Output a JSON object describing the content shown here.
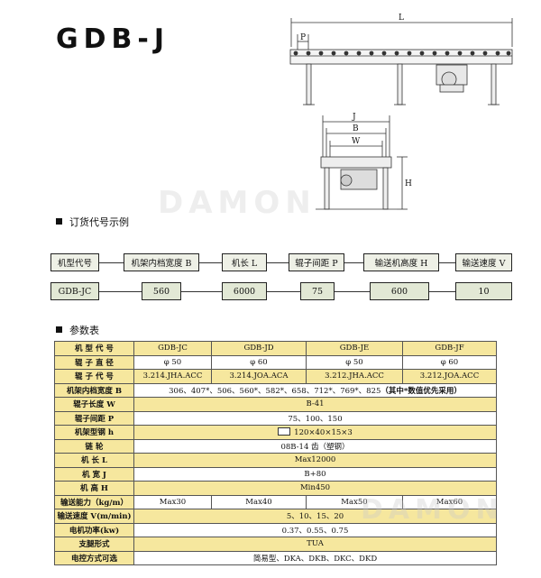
{
  "title": "GDB-J",
  "drawing": {
    "dim_L": "L",
    "dim_P": "P",
    "dim_J": "J",
    "dim_B": "B",
    "dim_W": "W",
    "dim_H": "H"
  },
  "watermark": "DAMON",
  "order": {
    "heading": "订货代号示例",
    "labels": [
      "机型代号",
      "机架内档宽度 B",
      "机长 L",
      "辊子间距 P",
      "输送机高度 H",
      "输送速度  V"
    ],
    "values": [
      "GDB-JC",
      "560",
      "6000",
      "75",
      "600",
      "10"
    ]
  },
  "params": {
    "heading": "参数表",
    "rows": [
      {
        "label": "机 型 代 号",
        "cells": [
          "GDB-JC",
          "GDB-JD",
          "GDB-JE",
          "GDB-JF"
        ]
      },
      {
        "label": "辊 子 直 径",
        "cells": [
          "φ 50",
          "φ 60",
          "φ 50",
          "φ 60"
        ]
      },
      {
        "label": "辊 子 代 号",
        "cells": [
          "3.214.JHA.ACC",
          "3.214.JOA.ACA",
          "3.212.JHA.ACC",
          "3.212.JOA.ACC"
        ]
      },
      {
        "label": "机架内档宽度 B",
        "span": "306、407*、506、560*、582*、658、712*、769*、825",
        "note": "（其中*数值优先采用）"
      },
      {
        "label": "辊子长度 W",
        "span": "B-41"
      },
      {
        "label": "辊子间距 P",
        "span": "75、100、150"
      },
      {
        "label": "机架型钢 h",
        "span": "120×40×15×3",
        "box_symbol": true
      },
      {
        "label": "链  轮",
        "span": "08B-14 齿（塑钢）"
      },
      {
        "label": "机  长 L",
        "span": "Max12000"
      },
      {
        "label": "机  宽 J",
        "span": "B+80"
      },
      {
        "label": "机  高 H",
        "span": "Min450"
      },
      {
        "label": "输送能力（kg/m）",
        "cells": [
          "Max30",
          "Max40",
          "Max50",
          "Max60"
        ]
      },
      {
        "label": "输送速度 V(m/min)",
        "span": "5、10、15、20"
      },
      {
        "label": "电机功率(kw)",
        "span": "0.37、0.55、0.75"
      },
      {
        "label": "支腿形式",
        "span": "TUA"
      },
      {
        "label": "电控方式可选",
        "span": "简易型、DKA、DKB、DKC、DKD"
      }
    ]
  }
}
